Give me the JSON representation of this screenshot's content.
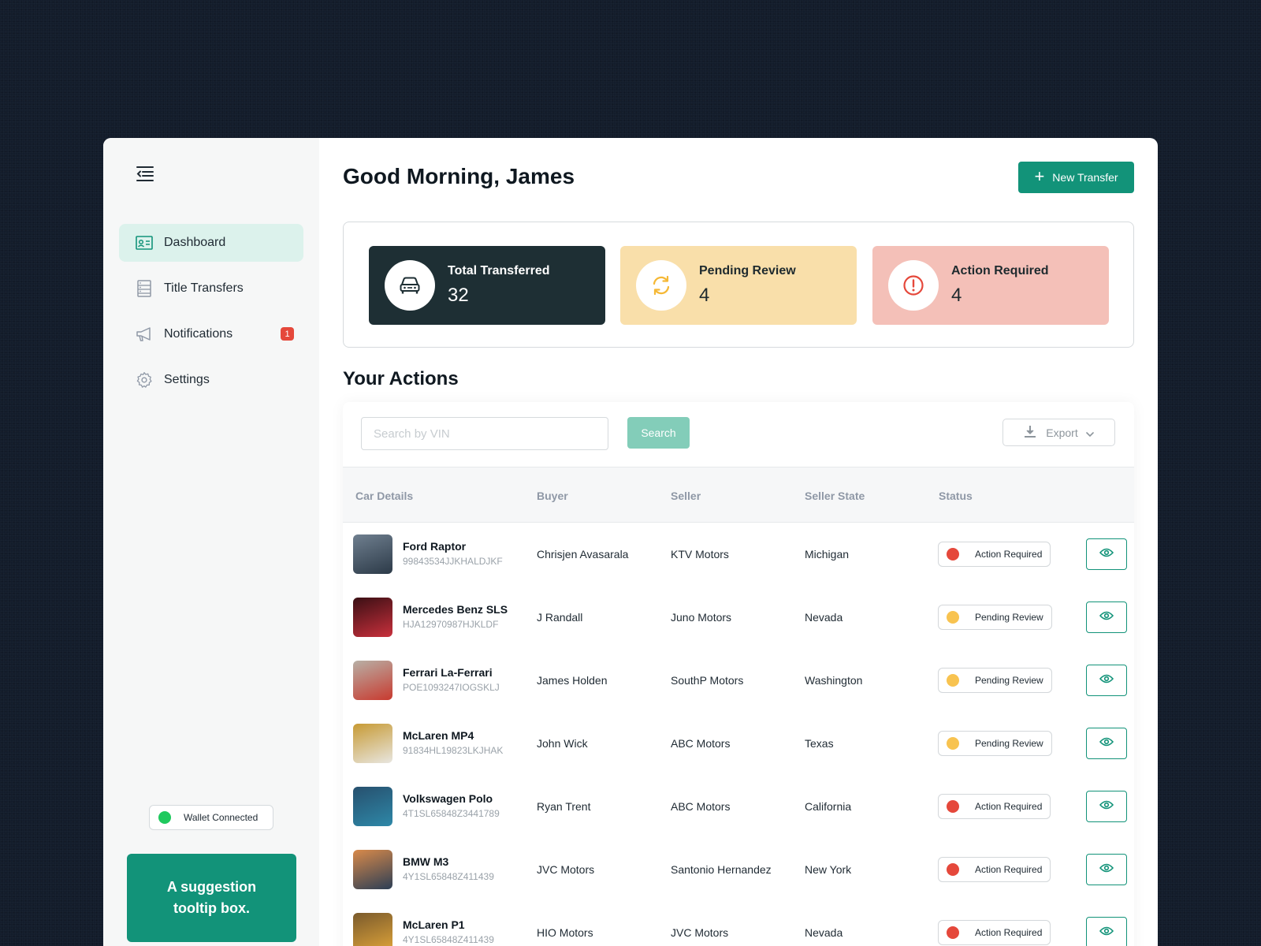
{
  "sidebar": {
    "items": [
      {
        "label": "Dashboard",
        "icon": "id-card-icon",
        "active": true
      },
      {
        "label": "Title Transfers",
        "icon": "document-list-icon"
      },
      {
        "label": "Notifications",
        "icon": "megaphone-icon",
        "badge": "1"
      },
      {
        "label": "Settings",
        "icon": "gear-icon"
      }
    ],
    "wallet_status": "Wallet Connected",
    "tooltip": "A suggestion tooltip box."
  },
  "header": {
    "greeting": "Good Morning, James",
    "new_transfer": "New Transfer"
  },
  "stats": [
    {
      "label": "Total Transferred",
      "value": "32",
      "icon": "car-icon"
    },
    {
      "label": "Pending Review",
      "value": "4",
      "icon": "refresh-icon"
    },
    {
      "label": "Action Required",
      "value": "4",
      "icon": "alert-circle-icon"
    }
  ],
  "actions": {
    "title": "Your Actions",
    "search_placeholder": "Search by VIN",
    "search_label": "Search",
    "export_label": "Export",
    "columns": [
      "Car Details",
      "Buyer",
      "Seller",
      "Seller State",
      "Status"
    ],
    "rows": [
      {
        "car": "Ford Raptor",
        "vin": "99843534JJKHALDJKF",
        "buyer": "Chrisjen Avasarala",
        "seller": "KTV Motors",
        "state": "Michigan",
        "status": "Action Required"
      },
      {
        "car": "Mercedes Benz SLS",
        "vin": "HJA12970987HJKLDF",
        "buyer": "J Randall",
        "seller": "Juno Motors",
        "state": "Nevada",
        "status": "Pending Review"
      },
      {
        "car": "Ferrari La-Ferrari",
        "vin": "POE1093247IOGSKLJ",
        "buyer": "James Holden",
        "seller": "SouthP Motors",
        "state": "Washington",
        "status": "Pending Review"
      },
      {
        "car": "McLaren MP4",
        "vin": "91834HL19823LKJHAK",
        "buyer": "John Wick",
        "seller": "ABC Motors",
        "state": "Texas",
        "status": "Pending Review"
      },
      {
        "car": "Volkswagen Polo",
        "vin": "4T1SL65848Z3441789",
        "buyer": "Ryan Trent",
        "seller": "ABC Motors",
        "state": "California",
        "status": "Action Required"
      },
      {
        "car": "BMW M3",
        "vin": "4Y1SL65848Z411439",
        "buyer": "JVC Motors",
        "seller": "Santonio Hernandez",
        "state": "New York",
        "status": "Action Required"
      },
      {
        "car": "McLaren P1",
        "vin": "4Y1SL65848Z411439",
        "buyer": "HIO Motors",
        "seller": "JVC Motors",
        "state": "Nevada",
        "status": "Action Required"
      }
    ]
  },
  "colors": {
    "accent": "#129379",
    "action_required": "#e5483b",
    "pending_review": "#f8c350",
    "wallet_connected": "#1fc95e"
  }
}
